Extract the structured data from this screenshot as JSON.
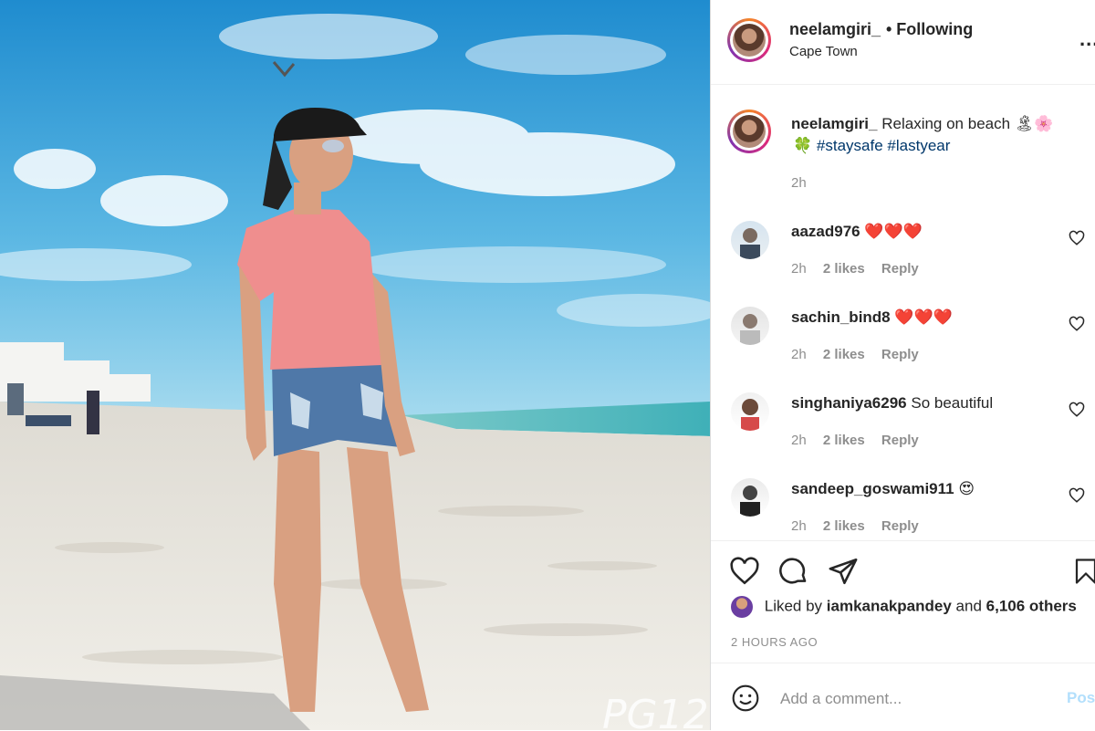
{
  "post": {
    "username": "neelamgiri_",
    "following_label": "• Following",
    "location": "Cape Town",
    "more_label": "...",
    "caption_text": "Relaxing on beach 🏝🌸",
    "caption_line2_emoji": "🍀",
    "hashtags": [
      "#staysafe",
      "#lastyear"
    ],
    "caption_time": "2h"
  },
  "comments": [
    {
      "username": "aazad976",
      "text": "❤️❤️❤️",
      "time": "2h",
      "likes": "2 likes",
      "reply": "Reply"
    },
    {
      "username": "sachin_bind8",
      "text": "❤️❤️❤️",
      "time": "2h",
      "likes": "2 likes",
      "reply": "Reply"
    },
    {
      "username": "singhaniya6296",
      "text": "So beautiful",
      "time": "2h",
      "likes": "2 likes",
      "reply": "Reply"
    },
    {
      "username": "sandeep_goswami911",
      "text": "😍",
      "time": "2h",
      "likes": "2 likes",
      "reply": "Reply"
    }
  ],
  "likes": {
    "prefix": "Liked by",
    "user": "iamkanakpandey",
    "joiner": "and",
    "others": "6,106 others"
  },
  "time_ago": "2 HOURS AGO",
  "add_comment": {
    "placeholder": "Add a comment...",
    "post_label": "Post"
  },
  "photo": {
    "watermark": "PG12"
  },
  "colors": {
    "text": "#262626",
    "muted": "#8e8e8e",
    "hashtag": "#00376b",
    "post_disabled": "#b2dffc",
    "sky": "#3aa3dc",
    "sand": "#e9e6e0",
    "shirt": "#ef8e8e"
  },
  "icons": [
    "heart-icon",
    "comment-icon",
    "share-icon",
    "bookmark-icon",
    "smiley-icon",
    "more-icon"
  ]
}
